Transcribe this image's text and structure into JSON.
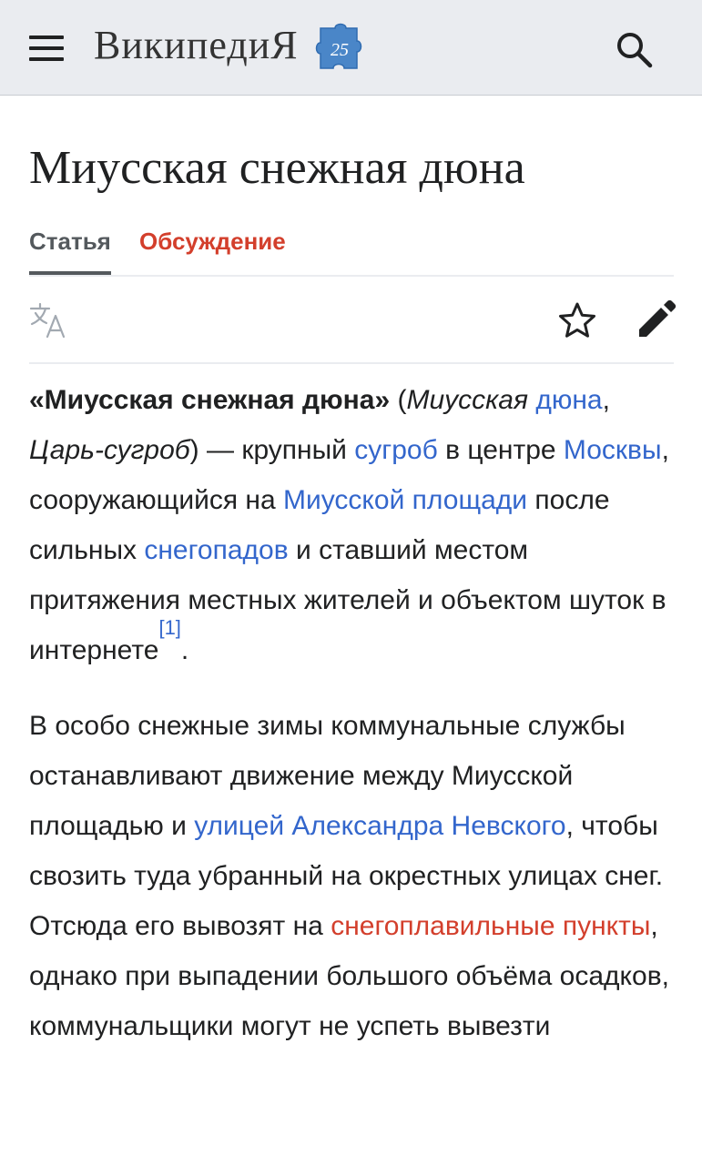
{
  "header": {
    "logo_text": "ВикипедиЯ",
    "logo_badge": "25",
    "menu_icon": "hamburger-menu-icon",
    "search_icon": "search-icon"
  },
  "article": {
    "title": "Миусская снежная дюна",
    "tabs": [
      {
        "label": "Статья",
        "active": true
      },
      {
        "label": "Обсуждение",
        "active": false
      }
    ],
    "toolbar": [
      "language-icon",
      "watch-star-icon",
      "edit-pencil-icon"
    ]
  },
  "paragraph1": {
    "t1": "«Миусская снежная дюна»",
    "t2": " (",
    "t3": "Миусская ",
    "l1": "дюна",
    "t4": ", ",
    "t5": "Царь-сугроб",
    "t6": ") — крупный ",
    "l2": "сугроб",
    "t7": " в центре ",
    "l3": "Москвы",
    "t8": ", сооружающийся на ",
    "l4": "Миусской площади",
    "t9": " после сильных ",
    "l5": "снегопадов",
    "t10": " и ставший местом притяжения местных жителей и объектом шуток в интернете",
    "ref": "[1]",
    "t11": "."
  },
  "paragraph2": {
    "t1": "В особо снежные зимы коммунальные службы останавливают движение между Миусской площадью и ",
    "l1": "улицей Александра Невского",
    "t2": ", чтобы свозить туда убранный на окрестных улицах снег. Отсюда его вывозят на ",
    "l2": "снегоплавильные пункты",
    "t3": ", однако при выпадении большого объёма осадков, коммунальщики могут не успеть вывезти"
  },
  "colors": {
    "link": "#3366cc",
    "redlink": "#d33f2c",
    "header_bg": "#eaecf0",
    "text": "#202122"
  }
}
